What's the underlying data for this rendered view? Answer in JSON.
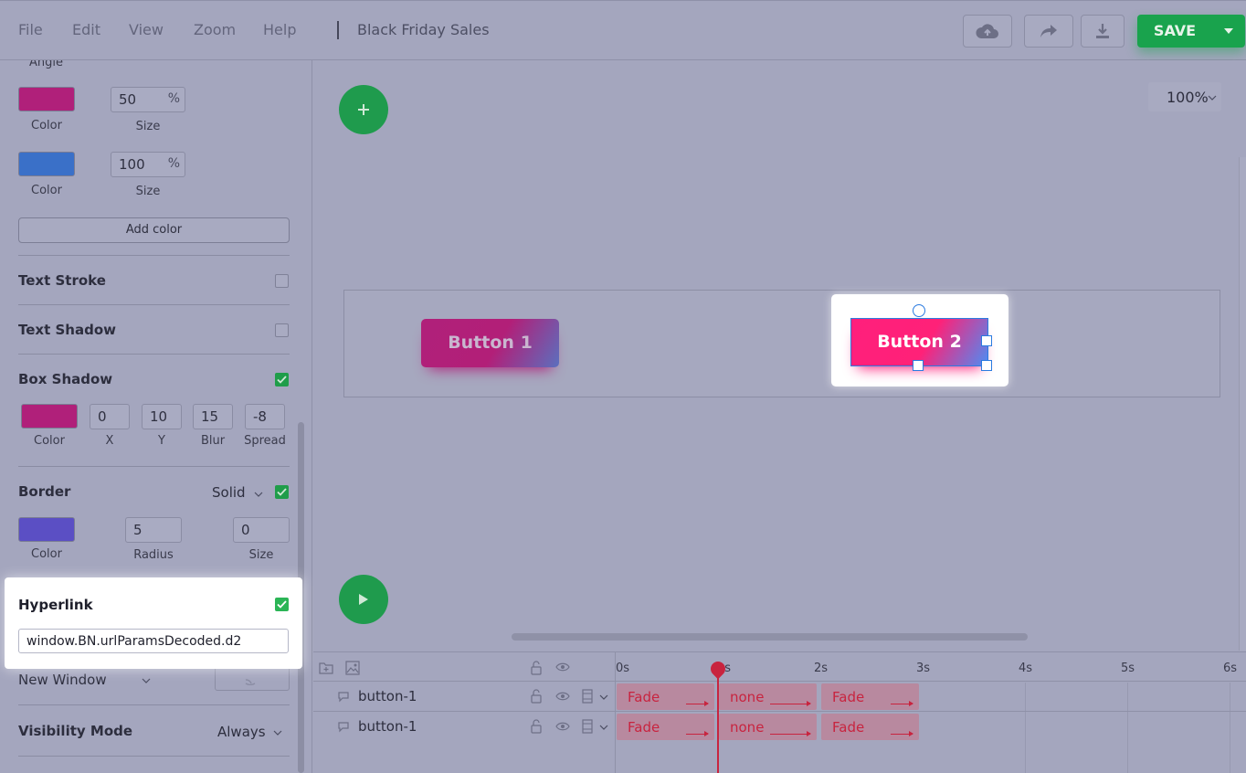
{
  "menu": {
    "items": [
      "File",
      "Edit",
      "View",
      "Zoom",
      "Help"
    ],
    "document_title": "Black Friday Sales"
  },
  "toolbar": {
    "save_label": "SAVE",
    "icons": [
      "cloud-upload-icon",
      "share-icon",
      "download-icon",
      "caret-down-icon"
    ]
  },
  "panel": {
    "angle_label": "Angle",
    "gradient_stops": [
      {
        "color": "#b0207a",
        "color_label": "Color",
        "size_value": "50",
        "size_unit": "%",
        "size_label": "Size"
      },
      {
        "color": "#3a70c8",
        "color_label": "Color",
        "size_value": "100",
        "size_unit": "%",
        "size_label": "Size"
      }
    ],
    "add_color_label": "Add color",
    "text_stroke": {
      "title": "Text Stroke",
      "checked": false
    },
    "text_shadow": {
      "title": "Text Shadow",
      "checked": false
    },
    "box_shadow": {
      "title": "Box Shadow",
      "checked": true,
      "color": "#b0207a",
      "color_label": "Color",
      "x": "0",
      "x_label": "X",
      "y": "10",
      "y_label": "Y",
      "blur": "15",
      "blur_label": "Blur",
      "spread": "-8",
      "spread_label": "Spread"
    },
    "border": {
      "title": "Border",
      "style": "Solid",
      "checked": true,
      "color": "#5b4fc4",
      "color_label": "Color",
      "radius": "5",
      "radius_label": "Radius",
      "size": "0",
      "size_label": "Size"
    },
    "hyperlink": {
      "title": "Hyperlink",
      "checked": true,
      "value": "window.BN.urlParamsDecoded.d2"
    },
    "new_window": {
      "label": "New Window"
    },
    "visibility": {
      "title": "Visibility Mode",
      "value": "Always"
    }
  },
  "canvas": {
    "zoom": "100%",
    "button1_label": "Button 1",
    "button2_label": "Button 2",
    "colors": {
      "button1": [
        "#b0207a",
        "#5b6fbe"
      ],
      "button2": [
        "#ff1f7c",
        "#4a8ef5"
      ]
    }
  },
  "timeline": {
    "ticks": [
      "0s",
      "1s",
      "2s",
      "3s",
      "4s",
      "5s",
      "6s"
    ],
    "layers": [
      {
        "name": "button-1",
        "clips": [
          "Fade",
          "none",
          "Fade"
        ]
      },
      {
        "name": "button-1",
        "clips": [
          "Fade",
          "none",
          "Fade"
        ]
      }
    ]
  }
}
